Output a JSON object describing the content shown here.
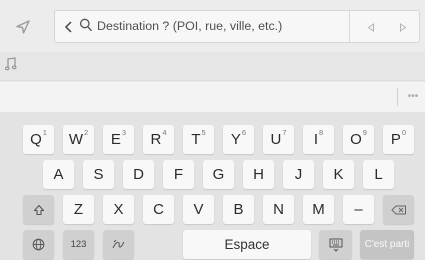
{
  "top_bar": {
    "nav_icon": "navigation-arrow-icon",
    "search": {
      "back_icon": "chevron-left-icon",
      "search_icon": "magnifier-icon",
      "placeholder": "Destination ? (POI, rue, ville, etc.)",
      "prev_icon": "triangle-left-icon",
      "next_icon": "triangle-right-icon"
    }
  },
  "music_icon": "music-note-icon",
  "suggestion_bar": {
    "more_icon": "ellipsis-icon"
  },
  "keyboard": {
    "row1": [
      {
        "label": "Q",
        "num": "1"
      },
      {
        "label": "W",
        "num": "2"
      },
      {
        "label": "E",
        "num": "3"
      },
      {
        "label": "R",
        "num": "4"
      },
      {
        "label": "T",
        "num": "5"
      },
      {
        "label": "Y",
        "num": "6"
      },
      {
        "label": "U",
        "num": "7"
      },
      {
        "label": "I",
        "num": "8"
      },
      {
        "label": "O",
        "num": "9"
      },
      {
        "label": "P",
        "num": "0"
      }
    ],
    "row2": [
      "A",
      "S",
      "D",
      "F",
      "G",
      "H",
      "J",
      "K",
      "L"
    ],
    "row3": [
      "Z",
      "X",
      "C",
      "V",
      "B",
      "N",
      "M",
      "–"
    ],
    "shift_icon": "shift-arrow-icon",
    "backspace_icon": "backspace-icon",
    "globe_icon": "globe-icon",
    "numbers_label": "123",
    "handwriting_icon": "handwriting-icon",
    "space_label": "Espace",
    "hide_keyboard_icon": "keyboard-hide-icon",
    "enter_label": "C'est parti"
  }
}
